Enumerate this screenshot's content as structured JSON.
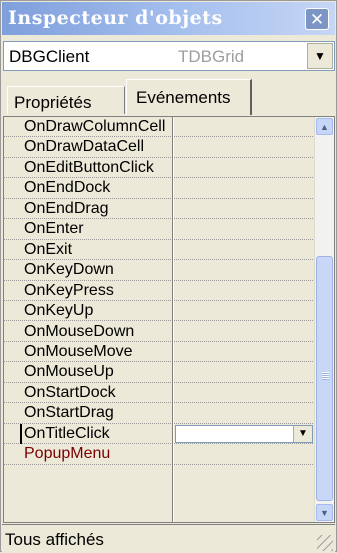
{
  "window": {
    "title": "Inspecteur d'objets",
    "close_icon": "close-icon"
  },
  "object_selector": {
    "name": "DBGClient",
    "type": "TDBGrid"
  },
  "tabs": [
    {
      "label": "Propriétés",
      "selected": false
    },
    {
      "label": "Evénements",
      "selected": true
    }
  ],
  "events": [
    "OnDrawColumnCell",
    "OnDrawDataCell",
    "OnEditButtonClick",
    "OnEndDock",
    "OnEndDrag",
    "OnEnter",
    "OnExit",
    "OnKeyDown",
    "OnKeyPress",
    "OnKeyUp",
    "OnMouseDown",
    "OnMouseMove",
    "OnMouseUp",
    "OnStartDock",
    "OnStartDrag",
    "OnTitleClick",
    "PopupMenu"
  ],
  "selected_event": "OnTitleClick",
  "selected_value": "",
  "status": {
    "text": "Tous affichés"
  },
  "colors": {
    "title_gradient_start": "#7f9fdc",
    "popup_menu_text": "#7a0000"
  }
}
